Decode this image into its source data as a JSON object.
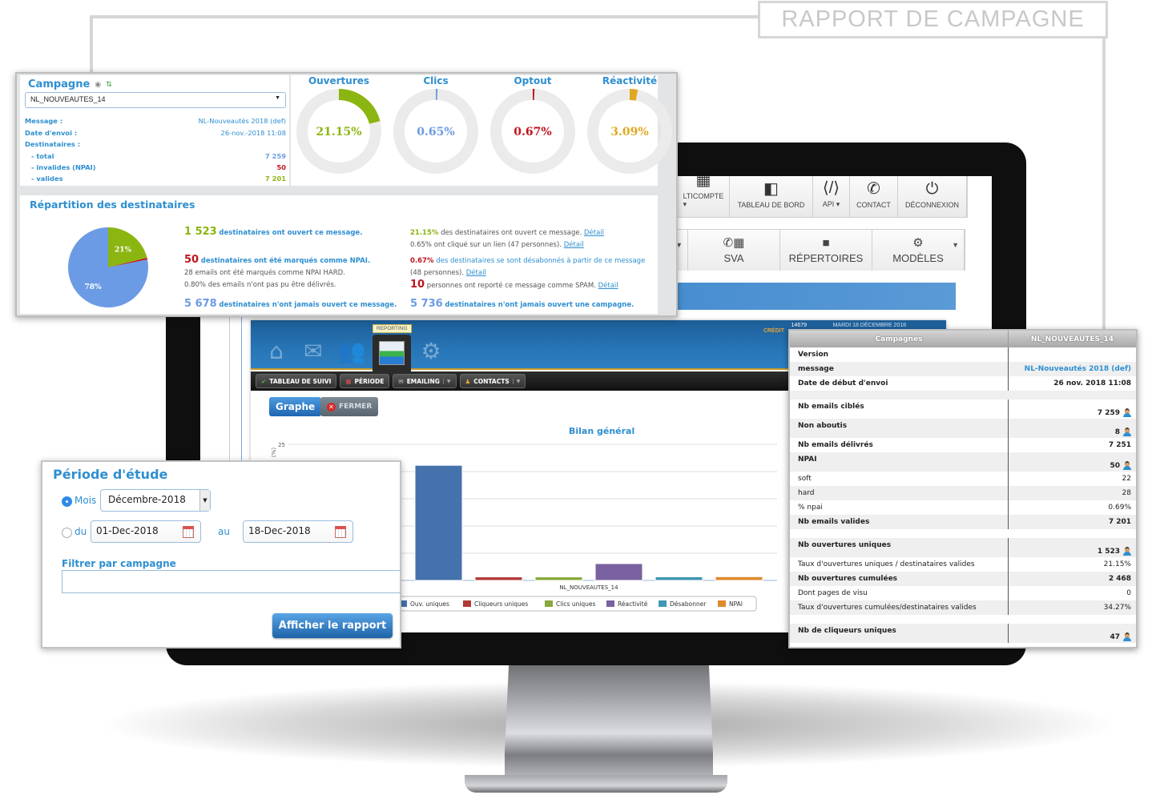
{
  "page_title": "RAPPORT DE CAMPAGNE",
  "campaign_summary": {
    "heading": "Campagne",
    "icons": [
      "refresh-icon",
      "swap-icon"
    ],
    "selected_campaign": "NL_NOUVEAUTES_14",
    "rows": [
      {
        "key": "Message :",
        "value": "NL-Nouveautés 2018 (def)",
        "color": "#2e8fd0"
      },
      {
        "key": "Date d'envoi :",
        "value": "26-nov.-2018 11:08",
        "color": "#2e8fd0"
      },
      {
        "key": "Destinataires :",
        "value": "",
        "color": "#2e8fd0"
      },
      {
        "key": "- total",
        "value": "7 259",
        "color": "#6c9be5"
      },
      {
        "key": "- invalides (NPAI)",
        "value": "50",
        "color": "#c0141d"
      },
      {
        "key": "- valides",
        "value": "7 201",
        "color": "#8bb510"
      }
    ],
    "gauges": [
      {
        "title": "Ouvertures",
        "label": "21.15%",
        "value": 21.15,
        "color": "#8bb510"
      },
      {
        "title": "Clics",
        "label": "0.65%",
        "value": 0.65,
        "color": "#6c9be5"
      },
      {
        "title": "Optout",
        "label": "0.67%",
        "value": 0.67,
        "color": "#c0141d"
      },
      {
        "title": "Réactivité",
        "label": "3.09%",
        "value": 3.09,
        "color": "#e0a820"
      }
    ],
    "repartition": {
      "title": "Répartition des destinataires",
      "pie": [
        {
          "label": "21%",
          "value": 21.15,
          "color": "#8bb510"
        },
        {
          "label": "",
          "value": 0.69,
          "color": "#c0141d"
        },
        {
          "label": "78%",
          "value": 78.16,
          "color": "#6c9be5"
        }
      ],
      "opened_count": "1 523",
      "opened_text": "destinataires ont ouvert ce message.",
      "npai_count": "50",
      "npai_text": "destinataires ont été marqués comme NPAI.",
      "npai_hard_text": "28 emails ont été marqués comme NPAI HARD.",
      "npai_pct_text": "0.80% des emails n'ont pas pu être délivrés.",
      "never_opened_msg_count": "5 678",
      "never_opened_msg_text": "destinataires n'ont jamais ouvert ce message.",
      "open_rate": "21.15%",
      "open_rate_text": "des destinataires ont ouvert ce message.",
      "click_text": "0.65% ont cliqué sur un lien (47 personnes).",
      "unsub_rate": "0.67%",
      "unsub_text": "des destinataires se sont désabonnés à partir de ce message",
      "unsub_count_text": "(48 personnes).",
      "spam_count": "10",
      "spam_text": "personnes ont reporté ce message comme SPAM.",
      "never_opened_camp_count": "5 736",
      "never_opened_camp_text": "destinataires n'ont jamais ouvert une campagne.",
      "detail_link": "Détail"
    }
  },
  "screen": {
    "top_nav": [
      {
        "icon": "building-icon",
        "glyph": "▦",
        "label": "LTICOMPTE ▾"
      },
      {
        "icon": "dashboard-icon",
        "glyph": "◧",
        "label": "TABLEAU DE BORD"
      },
      {
        "icon": "api-file-icon",
        "glyph": "⟨/⟩",
        "label": "API ▾"
      },
      {
        "icon": "phone-icon",
        "glyph": "✆",
        "label": "CONTACT"
      },
      {
        "icon": "power-icon",
        "glyph": "⏻",
        "label": "DÉCONNEXION"
      }
    ],
    "sub_nav": [
      {
        "icon": "phone-calculator-icon",
        "glyph": "✆▦",
        "label": "SVA"
      },
      {
        "icon": "folder-icon",
        "glyph": "■",
        "label": "RÉPERTOIRES"
      },
      {
        "icon": "gear-icon",
        "glyph": "⚙",
        "label": "MODÈLES"
      }
    ]
  },
  "reporting_app": {
    "tooltip": "REPORTING",
    "credit_label": "CRÉDIT",
    "credit_value": "14679",
    "date": "MARDI 18 DÉCEMBRE 2018",
    "toolbar": [
      {
        "icon": "check-icon",
        "glyph": "✔",
        "label": "TABLEAU DE SUIVI",
        "caret": false
      },
      {
        "icon": "calendar-icon",
        "glyph": "▦",
        "label": "PÉRIODE",
        "caret": false
      },
      {
        "icon": "envelope-icon",
        "glyph": "✉",
        "label": "EMAILING",
        "caret": true
      },
      {
        "icon": "contacts-icon",
        "glyph": "♟",
        "label": "CONTACTS",
        "caret": true
      }
    ],
    "graphe_button": "Graphe",
    "fermer_button": "FERMER"
  },
  "chart_data": {
    "type": "bar",
    "title": "Bilan général",
    "xlabel": "",
    "ylabel": "(%)",
    "categories": [
      "NL_NOUVEAUTES_14"
    ],
    "ylim": [
      0,
      25
    ],
    "y_ticks": [
      25
    ],
    "grid": true,
    "legend_position": "bottom",
    "series": [
      {
        "name": "Ouv. uniques",
        "values": [
          21.15
        ],
        "color": "#4571ad"
      },
      {
        "name": "Cliqueurs uniques",
        "values": [
          0.65
        ],
        "color": "#b23a36"
      },
      {
        "name": "Clics uniques",
        "values": [
          0.65
        ],
        "color": "#88a93b"
      },
      {
        "name": "Réactivité",
        "values": [
          3.09
        ],
        "color": "#7a62a0"
      },
      {
        "name": "Désabonner",
        "values": [
          0.67
        ],
        "color": "#3f97b3"
      },
      {
        "name": "NPAI",
        "values": [
          0.69
        ],
        "color": "#de8a2e"
      }
    ]
  },
  "period": {
    "title": "Période d'étude",
    "mois_label": "Mois",
    "mois_value": "Décembre-2018",
    "du_label": "du",
    "date_from": "01-Dec-2018",
    "au_label": "au",
    "date_to": "18-Dec-2018",
    "filter_label": "Filtrer par campagne",
    "filter_value": "",
    "submit_label": "Afficher le rapport",
    "selected_mode": "mois"
  },
  "detail_table": {
    "headers": [
      "Campagnes",
      "NL_NOUVEAUTES_14"
    ],
    "rows": [
      {
        "label": "Version",
        "value": "",
        "bold": true,
        "style": "short",
        "alt": false,
        "icon": false
      },
      {
        "label": "message",
        "value": "NL-Nouveautés 2018 (def)",
        "bold": true,
        "style": "short",
        "alt": true,
        "icon": false,
        "link": true
      },
      {
        "label": "Date de début d'envoi",
        "value": "26 nov. 2018 11:08",
        "bold": true,
        "style": "short",
        "alt": false,
        "icon": false
      },
      {
        "label": "",
        "value": "",
        "bold": false,
        "style": "spacer",
        "alt": true,
        "icon": false
      },
      {
        "label": "Nb emails ciblés",
        "value": "7 259",
        "bold": true,
        "style": "tall",
        "alt": false,
        "icon": true
      },
      {
        "label": "Non aboutis",
        "value": "8",
        "bold": true,
        "style": "tall",
        "alt": true,
        "icon": true
      },
      {
        "label": "Nb emails délivrés",
        "value": "7 251",
        "bold": true,
        "style": "short",
        "alt": false,
        "icon": false
      },
      {
        "label": "NPAI",
        "value": "50",
        "bold": true,
        "style": "tall",
        "alt": true,
        "icon": true
      },
      {
        "label": "soft",
        "value": "22",
        "bold": false,
        "style": "short",
        "alt": false,
        "icon": false
      },
      {
        "label": "hard",
        "value": "28",
        "bold": false,
        "style": "short",
        "alt": true,
        "icon": false
      },
      {
        "label": "% npai",
        "value": "0.69%",
        "bold": false,
        "style": "short",
        "alt": false,
        "icon": false
      },
      {
        "label": "Nb emails valides",
        "value": "7 201",
        "bold": true,
        "style": "short",
        "alt": true,
        "icon": false
      },
      {
        "label": "",
        "value": "",
        "bold": false,
        "style": "spacer",
        "alt": false,
        "icon": false
      },
      {
        "label": "Nb ouvertures uniques",
        "value": "1 523",
        "bold": true,
        "style": "tall",
        "alt": true,
        "icon": true
      },
      {
        "label": "Taux d'ouvertures uniques / destinataires valides",
        "value": "21.15%",
        "bold": false,
        "style": "short",
        "alt": false,
        "icon": false
      },
      {
        "label": "Nb ouvertures cumulées",
        "value": "2 468",
        "bold": true,
        "style": "short",
        "alt": true,
        "icon": false
      },
      {
        "label": "Dont pages de visu",
        "value": "0",
        "bold": false,
        "style": "short",
        "alt": false,
        "icon": false
      },
      {
        "label": "Taux d'ouvertures cumulées/destinataires valides",
        "value": "34.27%",
        "bold": false,
        "style": "short",
        "alt": true,
        "icon": false
      },
      {
        "label": "",
        "value": "",
        "bold": false,
        "style": "spacer",
        "alt": false,
        "icon": false
      },
      {
        "label": "Nb de cliqueurs uniques",
        "value": "47",
        "bold": true,
        "style": "tall",
        "alt": true,
        "icon": true
      }
    ]
  }
}
